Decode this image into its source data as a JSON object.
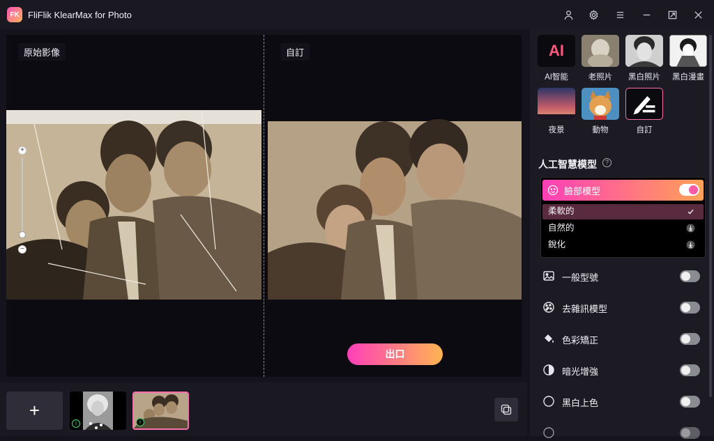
{
  "titlebar": {
    "logo_text": "FK",
    "title": "FliFlik KlearMax for Photo",
    "icons": [
      "user-icon",
      "gear-icon",
      "menu-icon",
      "minimize-icon",
      "maximize-icon",
      "close-icon"
    ]
  },
  "workspace": {
    "original_label": "原始影像",
    "result_label": "自訂",
    "export_label": "出口"
  },
  "presets": [
    {
      "label": "AI智能",
      "icon_text": "AI",
      "icon": "ai-icon"
    },
    {
      "label": "老照片",
      "icon": "old-photo-thumb"
    },
    {
      "label": "黑白照片",
      "icon": "bw-photo-thumb"
    },
    {
      "label": "黑白漫畫",
      "icon": "bw-manga-thumb"
    },
    {
      "label": "夜景",
      "icon": "night-scene-thumb"
    },
    {
      "label": "動物",
      "icon": "animal-thumb"
    },
    {
      "label": "自訂",
      "icon": "custom-pen-icon",
      "selected": true
    }
  ],
  "ai_models": {
    "title": "人工智慧模型",
    "face_model": {
      "label": "臉部模型",
      "enabled": true,
      "options": [
        {
          "label": "柔軟的",
          "selected": true
        },
        {
          "label": "自然的",
          "selected": false
        },
        {
          "label": "銳化",
          "selected": false
        }
      ]
    },
    "models": [
      {
        "label": "一般型號",
        "icon": "image-icon",
        "enabled": false
      },
      {
        "label": "去雜訊模型",
        "icon": "noise-icon",
        "enabled": false
      },
      {
        "label": "色彩矯正",
        "icon": "paint-bucket-icon",
        "enabled": false
      },
      {
        "label": "暗光增強",
        "icon": "contrast-icon",
        "enabled": false
      },
      {
        "label": "黑白上色",
        "icon": "colorize-icon",
        "enabled": false
      }
    ]
  },
  "bottombar": {
    "add_label": "+",
    "thumbnails": [
      {
        "name": "marilyn-thumb",
        "selected": false
      },
      {
        "name": "family-thumb",
        "selected": true
      }
    ]
  },
  "colors": {
    "accent_start": "#ff3fb8",
    "accent_end": "#ffb552",
    "panel_bg": "#1c1b24",
    "canvas_bg": "#0c0b12"
  }
}
